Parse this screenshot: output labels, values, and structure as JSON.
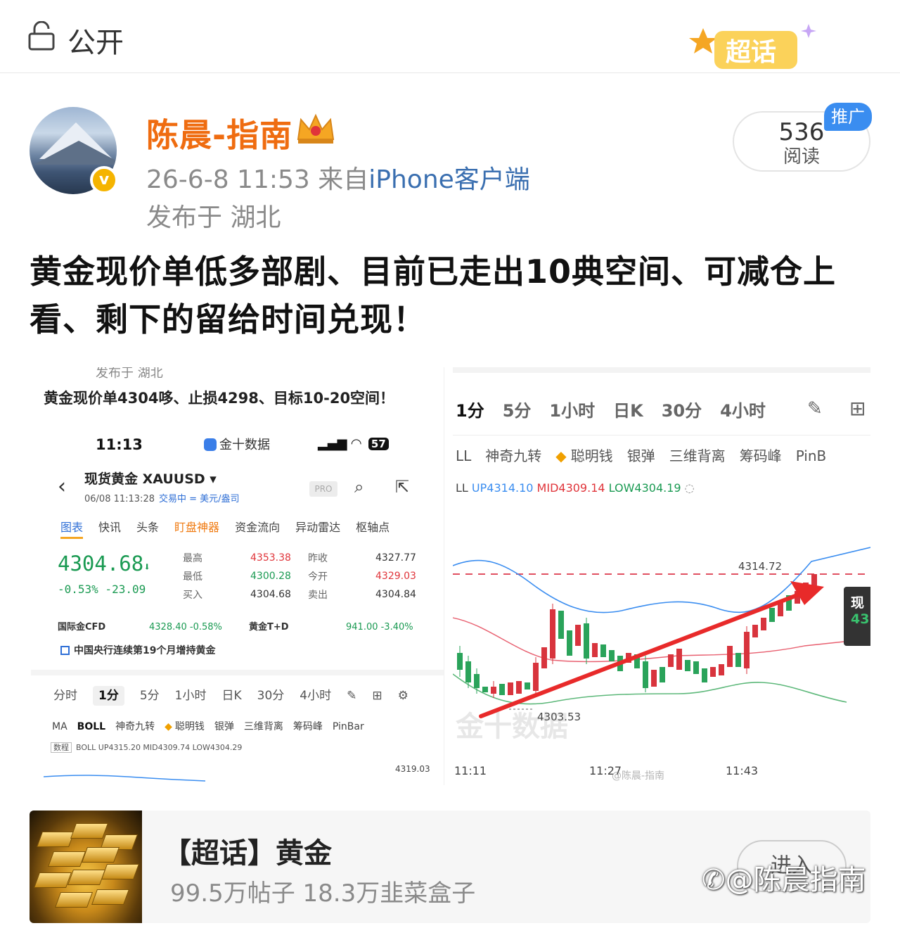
{
  "top_bar": {
    "privacy_label": "公开",
    "badge_text": "超话"
  },
  "user": {
    "name": "陈晨-指南",
    "meta_time": "26-6-8 11:53",
    "meta_from": "来自",
    "meta_source": "iPhone客户端",
    "location": "发布于 湖北"
  },
  "reads": {
    "count": "536",
    "label": "阅读",
    "promo_label": "推广"
  },
  "post": {
    "text": "黄金现价单低多部剧、目前已走出10典空间、可减仓上看、剩下的留给时间兑现！"
  },
  "left_image": {
    "cut_top": "发布于 湖北",
    "title": "黄金现价单4304哆、止损4298、目标10-20空间！",
    "clock": "11:13",
    "app_name": "金十数据",
    "battery": "57",
    "instrument": "现货黄金 XAUUSD ▾",
    "datetime": "06/08 11:13:28",
    "status_tags": "交易中 = 美元/盎司",
    "pro_label": "PRO",
    "tabs": [
      "图表",
      "快讯",
      "头条",
      "盯盘神器",
      "资金流向",
      "异动雷达",
      "枢轴点"
    ],
    "price": "4304.68",
    "price_arrow": "⬇",
    "change": "-0.53%  -23.09",
    "grid": [
      {
        "l1": "最高",
        "v1": "4353.38",
        "l2": "昨收",
        "v2": "4327.77"
      },
      {
        "l1": "最低",
        "v1": "4300.28",
        "l2": "今开",
        "v2": "4329.03"
      },
      {
        "l1": "买入",
        "v1": "4304.68",
        "l2": "卖出",
        "v2": "4304.84"
      }
    ],
    "cfd_label": "国际金CFD",
    "cfd_value": "4328.40  -0.58%",
    "td_label": "黄金T+D",
    "td_value": "941.00  -3.40%",
    "news": "中国央行连续第19个月增持黄金",
    "periods": [
      "分时",
      "1分",
      "5分",
      "1小时",
      "日K",
      "30分",
      "4小时"
    ],
    "indicators": [
      "MA",
      "BOLL",
      "神奇九转",
      "聪明钱",
      "银弹",
      "三维背离",
      "筹码峰",
      "PinBar"
    ],
    "boll_box": "数程",
    "boll_text": "BOLL UP4315.20 MID4309.74 LOW4304.29",
    "right_num": "4319.03"
  },
  "right_image": {
    "periods": [
      "1分",
      "5分",
      "1小时",
      "日K",
      "30分",
      "4小时"
    ],
    "indicators": [
      "LL",
      "神奇九转",
      "聪明钱",
      "银弹",
      "三维背离",
      "筹码峰",
      "PinB"
    ],
    "boll_prefix": "LL",
    "boll_up": "UP4314.10",
    "boll_mid": "MID4309.14",
    "boll_low": "LOW4304.19",
    "high_label": "4314.72",
    "low_label": "4303.53",
    "x_labels": [
      "11:11",
      "11:27",
      "11:43"
    ],
    "price_tag_top": "现",
    "price_tag_bottom": "43",
    "watermark": "金十数据",
    "watermark2": "@陈晨-指南"
  },
  "topic": {
    "title": "【超话】黄金",
    "stats": "99.5万帖子 18.3万韭菜盒子",
    "enter_label": "进入",
    "weibo_watermark": "@陈晨指南"
  }
}
